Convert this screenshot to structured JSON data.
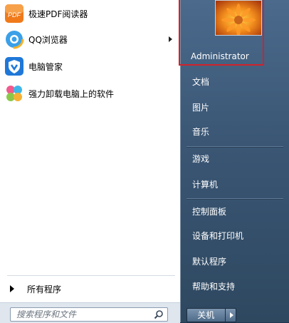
{
  "programs": [
    {
      "label": "极速PDF阅读器",
      "icon": "pdf-reader-icon",
      "has_submenu": false,
      "icon_text": "PDF"
    },
    {
      "label": "QQ浏览器",
      "icon": "qq-browser-icon",
      "has_submenu": true
    },
    {
      "label": "电脑管家",
      "icon": "pc-manager-shield-icon",
      "has_submenu": false
    },
    {
      "label": "强力卸载电脑上的软件",
      "icon": "uninstaller-icon",
      "has_submenu": false
    }
  ],
  "all_programs_label": "所有程序",
  "search": {
    "placeholder": "搜索程序和文件"
  },
  "user": {
    "name": "Administrator"
  },
  "right_links": [
    {
      "label": "文档"
    },
    {
      "label": "图片"
    },
    {
      "label": "音乐"
    },
    {
      "label": "游戏"
    },
    {
      "label": "计算机"
    },
    {
      "label": "控制面板"
    },
    {
      "label": "设备和打印机"
    },
    {
      "label": "默认程序"
    },
    {
      "label": "帮助和支持"
    }
  ],
  "shutdown": {
    "label": "关机"
  },
  "colors": {
    "highlight_border": "#d0222a",
    "right_pane": "#3a5674"
  }
}
